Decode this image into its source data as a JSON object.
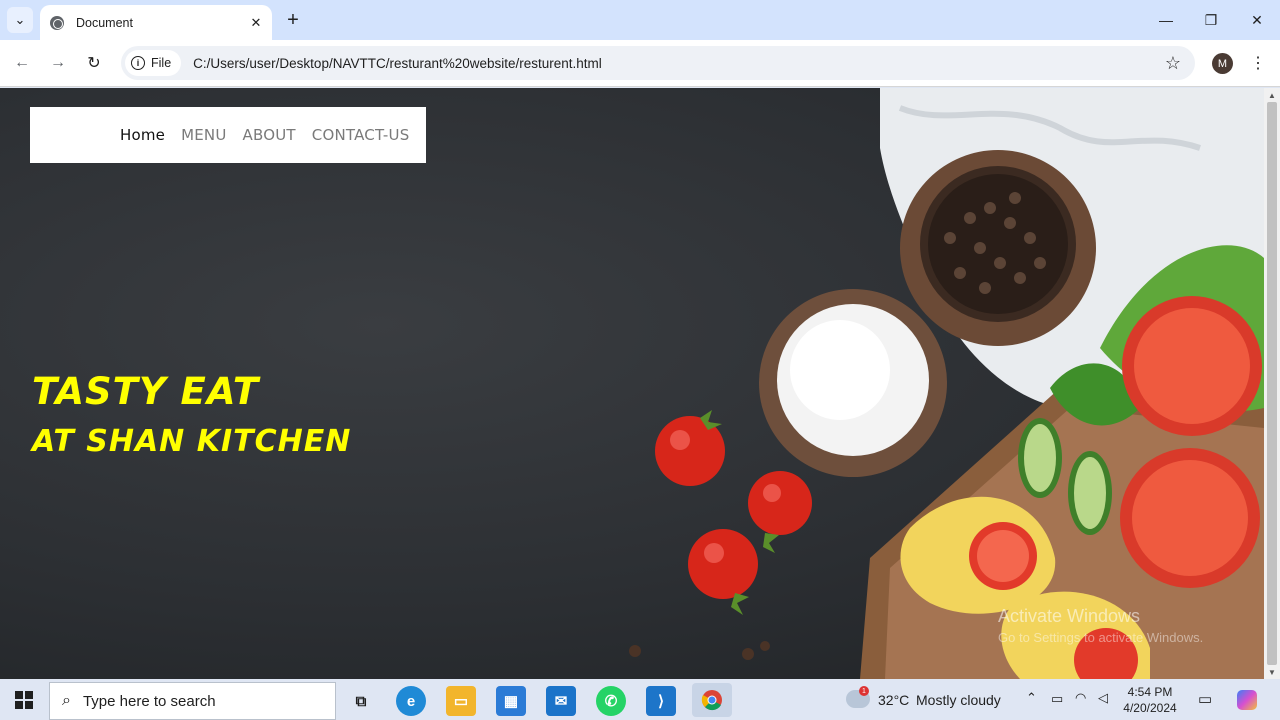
{
  "browser": {
    "tab_title": "Document",
    "chip_label": "File",
    "url": "C:/Users/user/Desktop/NAVTTC/resturant%20website/resturent.html",
    "profile_initial": "M"
  },
  "site": {
    "nav": [
      {
        "label": "Home",
        "active": true
      },
      {
        "label": "MENU",
        "active": false
      },
      {
        "label": "ABOUT",
        "active": false
      },
      {
        "label": "CONTACT-US",
        "active": false
      }
    ],
    "hero_title": "TASTY EAT",
    "hero_subtitle": "AT SHAN KITCHEN",
    "hero_color": "#ffff00",
    "nav_background": "#ffffff"
  },
  "watermark": {
    "line1": "Activate Windows",
    "line2": "Go to Settings to activate Windows."
  },
  "taskbar": {
    "search_placeholder": "Type here to search",
    "weather_temp": "32°C",
    "weather_desc": "Mostly cloudy",
    "weather_badge": "1",
    "time": "4:54 PM",
    "date": "4/20/2024",
    "apps": [
      "task-view-icon",
      "edge-icon",
      "file-explorer-icon",
      "store-icon",
      "mail-icon",
      "whatsapp-icon",
      "vscode-icon",
      "chrome-icon"
    ]
  },
  "colors": {
    "tabstrip": "#d3e3fd",
    "taskbar": "#dfe6f3"
  }
}
